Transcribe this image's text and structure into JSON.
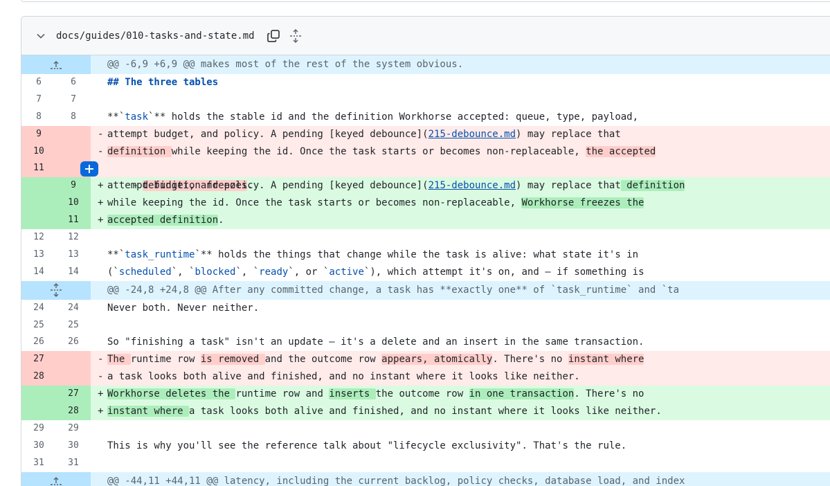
{
  "file": {
    "path": "docs/guides/010-tasks-and-state.md",
    "icons": {
      "collapse": "chevron-down-icon",
      "copy": "copy-icon",
      "expand": "unfold-icon",
      "comment": "plus-icon"
    }
  },
  "colors": {
    "add_bg": "#dafbe1",
    "add_gutter": "#aceebb",
    "del_bg": "#ffebe9",
    "del_gutter": "#ffcecb",
    "hunk_bg": "#ddf4ff",
    "hunk_gutter": "#b6e3ff",
    "accent": "#0969da"
  },
  "hunks": [
    "@@ -6,9 +6,9 @@ makes most of the rest of the system obvious.",
    "@@ -24,8 +24,8 @@ After any committed change, a task has **exactly one** of `task_runtime` and `ta",
    "@@ -44,11 +44,11 @@ latency, including the current backlog, policy checks, database load, and index"
  ],
  "lines": {
    "l6": {
      "old": "6",
      "new": "6",
      "text": "## The three tables"
    },
    "l7": {
      "old": "7",
      "new": "7",
      "text": ""
    },
    "l8": {
      "old": "8",
      "new": "8",
      "a": "**`",
      "b": "task",
      "c": "`** holds the stable id and the definition Workhorse accepted: queue, type, payload,"
    },
    "d9": {
      "old": "9",
      "sign": "-",
      "a": "attempt budget, and policy. A pending [keyed debounce](",
      "b": "215-debounce.md",
      "c": ") may replace that"
    },
    "d10": {
      "old": "10",
      "sign": "-",
      "a": "definition ",
      "b": "while keeping the id. Once the task starts or becomes non-replaceable, ",
      "c": "the accepted"
    },
    "d11": {
      "old": "11",
      "sign": "-",
      "a": "definition freezes",
      "b": "."
    },
    "a9": {
      "new": "9",
      "sign": "+",
      "a": "attempt budget, and policy. A pending [keyed debounce](",
      "b": "215-debounce.md",
      "c": ") may replace that",
      "d": " definition"
    },
    "a10": {
      "new": "10",
      "sign": "+",
      "a": "while keeping the id. Once the task starts or becomes non-replaceable, ",
      "b": "Workhorse freezes the"
    },
    "a11": {
      "new": "11",
      "sign": "+",
      "a": "accepted definition",
      "b": "."
    },
    "l12": {
      "old": "12",
      "new": "12",
      "text": ""
    },
    "l13": {
      "old": "13",
      "new": "13",
      "a": "**`",
      "b": "task_runtime",
      "c": "`** holds the things that change while the task is alive: what state it's in"
    },
    "l14": {
      "old": "14",
      "new": "14",
      "p1": "(`",
      "s1": "scheduled",
      "p2": "`, `",
      "s2": "blocked",
      "p3": "`, `",
      "s3": "ready",
      "p4": "`, or `",
      "s4": "active",
      "p5": "`), which attempt it's on, and — if something is"
    },
    "l24": {
      "old": "24",
      "new": "24",
      "text": "Never both. Never neither."
    },
    "l25": {
      "old": "25",
      "new": "25",
      "text": ""
    },
    "l26": {
      "old": "26",
      "new": "26",
      "text": "So \"finishing a task\" isn't an update — it's a delete and an insert in the same transaction."
    },
    "d27": {
      "old": "27",
      "sign": "-",
      "m1": "The ",
      "t1": "runtime row ",
      "m2": "is removed ",
      "t2": "and the outcome row ",
      "m3": "appears, atomically",
      "t3": ". There's no ",
      "m4": "instant where"
    },
    "d28": {
      "old": "28",
      "sign": "-",
      "text": "a task looks both alive and finished, and no instant where it looks like neither."
    },
    "a27": {
      "new": "27",
      "sign": "+",
      "m1": "Workhorse deletes the ",
      "t1": "runtime row and ",
      "m2": "inserts ",
      "t2": "the outcome row ",
      "m3": "in one transaction",
      "t3": ". There's no"
    },
    "a28": {
      "new": "28",
      "sign": "+",
      "m1": "instant where ",
      "t1": "a task looks both alive and finished, and no instant where it looks like neither."
    },
    "l29": {
      "old": "29",
      "new": "29",
      "text": ""
    },
    "l30": {
      "old": "30",
      "new": "30",
      "text": "This is why you'll see the reference talk about \"lifecycle exclusivity\". That's the rule."
    },
    "l31": {
      "old": "31",
      "new": "31",
      "text": ""
    }
  }
}
